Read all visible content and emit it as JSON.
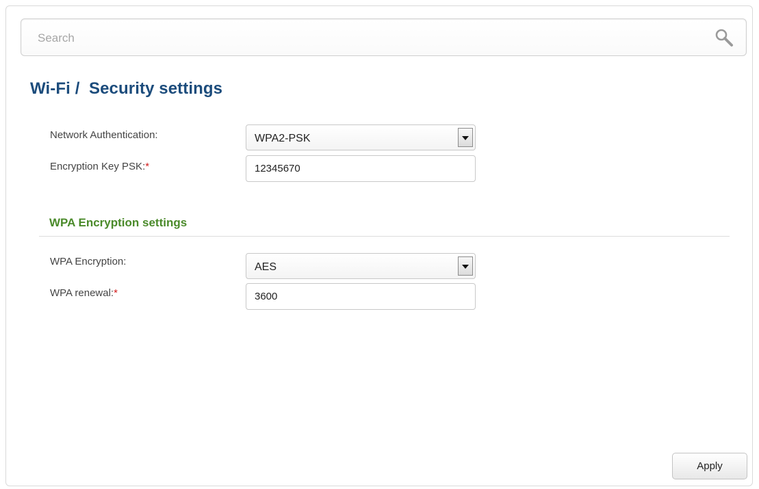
{
  "search": {
    "placeholder": "Search",
    "icon": "search-icon"
  },
  "header": {
    "title": "Wi-Fi /  Security settings"
  },
  "security": {
    "network_auth_label": "Network Authentication:",
    "network_auth_value": "WPA2-PSK",
    "psk_label": "Encryption Key PSK:",
    "psk_required_mark": "*",
    "psk_value": "12345670"
  },
  "wpa_section": {
    "title": "WPA Encryption settings",
    "encryption_label": "WPA Encryption:",
    "encryption_value": "AES",
    "renewal_label": "WPA renewal:",
    "renewal_required_mark": "*",
    "renewal_value": "3600"
  },
  "actions": {
    "apply_label": "Apply"
  },
  "colors": {
    "title": "#1c4c7c",
    "section_title": "#4a8a2a",
    "required": "#d21c1c"
  }
}
